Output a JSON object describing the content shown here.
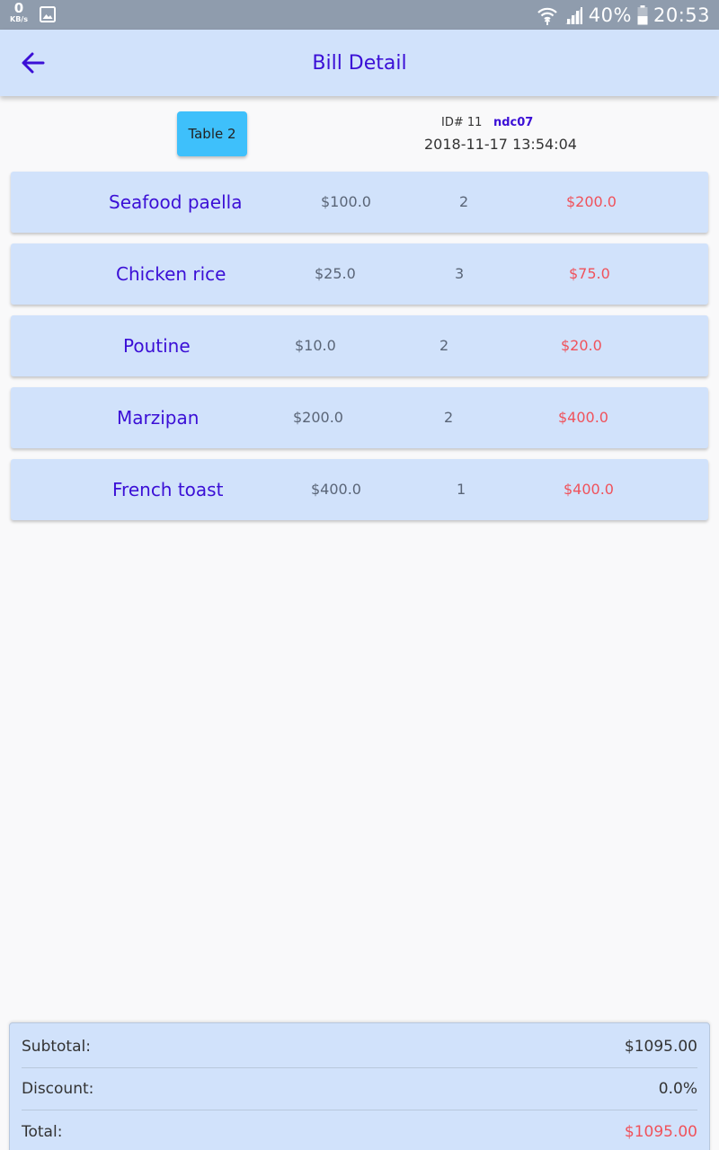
{
  "status_bar": {
    "net_speed_value": "0",
    "net_speed_unit": "KB/s",
    "battery": "40%",
    "time": "20:53"
  },
  "app_bar": {
    "title": "Bill Detail"
  },
  "bill": {
    "table_label": "Table 2",
    "id": "ID# 11",
    "user": "ndc07",
    "timestamp": "2018-11-17 13:54:04"
  },
  "items": [
    {
      "name": "Seafood paella",
      "price": "$100.0",
      "qty": "2",
      "total": "$200.0"
    },
    {
      "name": "Chicken rice",
      "price": "$25.0",
      "qty": "3",
      "total": "$75.0"
    },
    {
      "name": "Poutine",
      "price": "$10.0",
      "qty": "2",
      "total": "$20.0"
    },
    {
      "name": "Marzipan",
      "price": "$200.0",
      "qty": "2",
      "total": "$400.0"
    },
    {
      "name": "French toast",
      "price": "$400.0",
      "qty": "1",
      "total": "$400.0"
    }
  ],
  "summary": {
    "subtotal_label": "Subtotal:",
    "subtotal_value": "$1095.00",
    "discount_label": "Discount:",
    "discount_value": "0.0%",
    "total_label": "Total:",
    "total_value": "$1095.00"
  },
  "colors": {
    "accent": "#3b0fd6",
    "row_background": "#d1e2fb",
    "table_button": "#3ec0fb",
    "amount_red": "#f0525b",
    "status_bar": "#8f9cad"
  },
  "icons": {
    "back": "arrow-left-icon",
    "gallery": "image-icon",
    "wifi": "wifi-icon",
    "signal": "signal-icon",
    "battery": "battery-icon"
  }
}
